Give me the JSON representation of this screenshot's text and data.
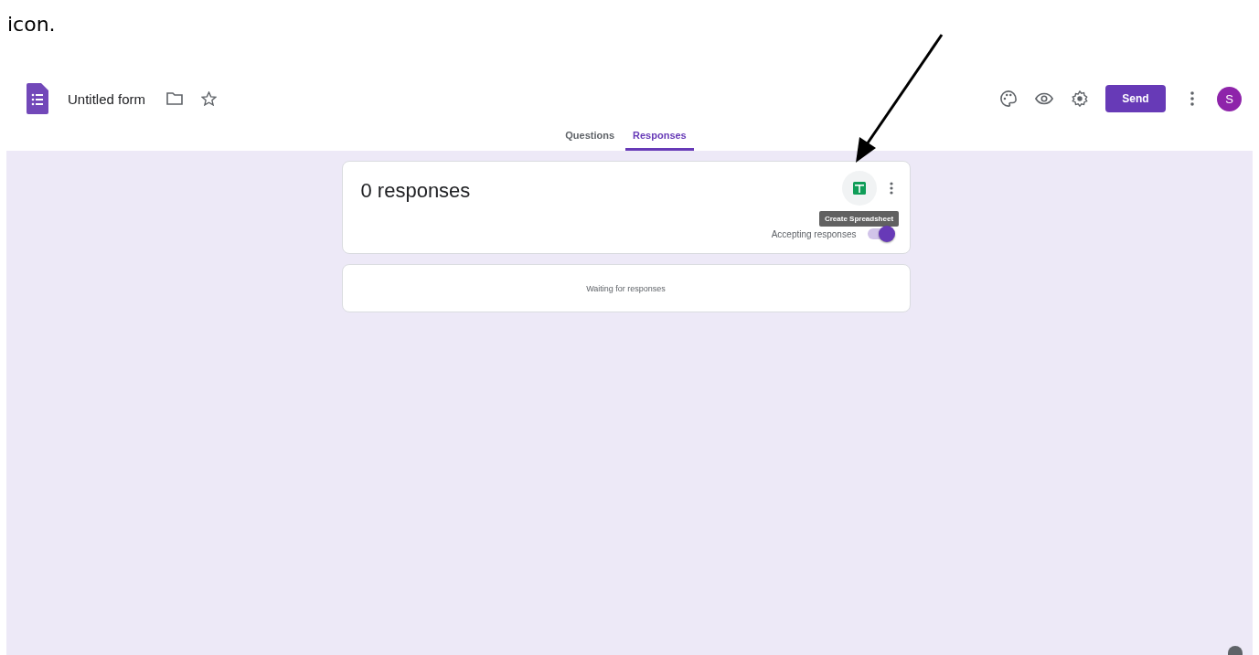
{
  "caption": "icon.",
  "header": {
    "title": "Untitled form",
    "send": "Send",
    "avatar": "S"
  },
  "tabs": [
    {
      "label": "Questions",
      "selected": false
    },
    {
      "label": "Responses",
      "selected": true
    }
  ],
  "summary": {
    "count": "0 responses",
    "tooltip": "Create Spreadsheet",
    "accepting_label": "Accepting responses",
    "accepting_on": true
  },
  "waiting": "Waiting for responses"
}
